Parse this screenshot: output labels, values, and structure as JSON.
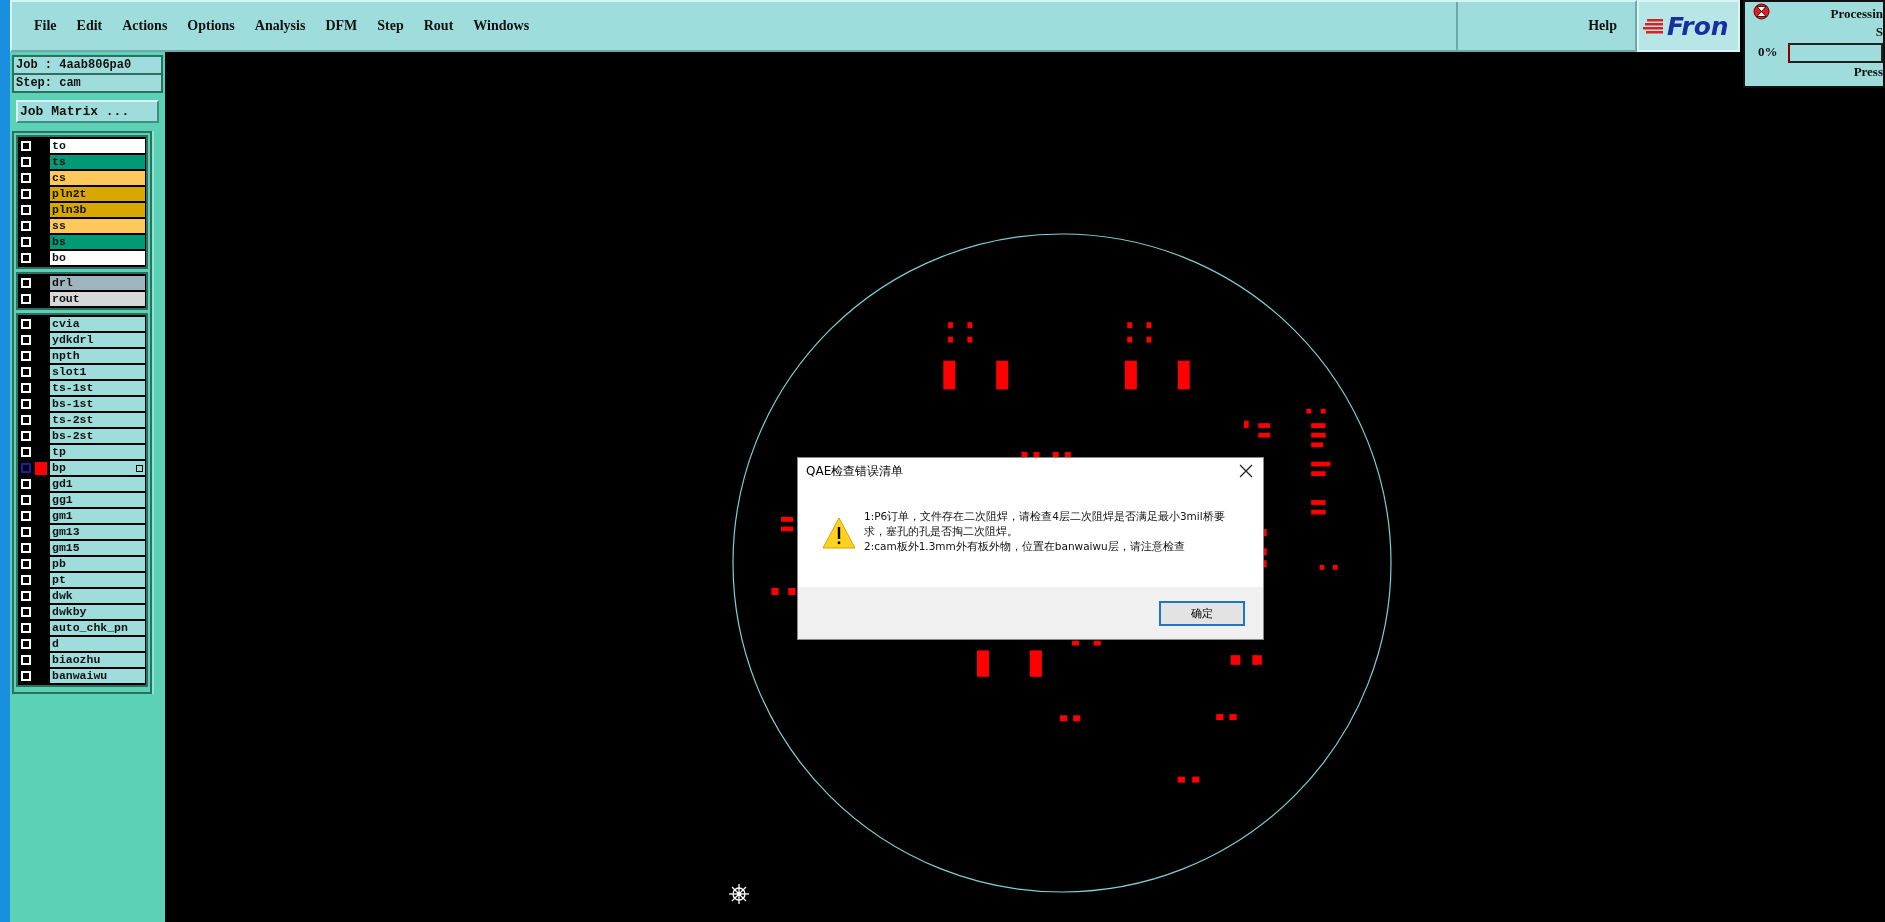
{
  "menu": {
    "items": [
      "File",
      "Edit",
      "Actions",
      "Options",
      "Analysis",
      "DFM",
      "Step",
      "Rout",
      "Windows"
    ],
    "help": "Help"
  },
  "logo": {
    "text": "Fron"
  },
  "processing": {
    "title": "Processin",
    "subtitle": "S",
    "percent": "0%",
    "level": 0,
    "hint": "Press"
  },
  "job": {
    "job": "Job : 4aab806pa0",
    "step": "Step: cam",
    "matrix_button": "Job Matrix ..."
  },
  "layer_groups": [
    {
      "layers": [
        {
          "name": "to",
          "color": "#ffffff",
          "checked": false,
          "active": false
        },
        {
          "name": "ts",
          "color": "#009a76",
          "checked": false,
          "active": false
        },
        {
          "name": "cs",
          "color": "#ffc85a",
          "checked": false,
          "active": false
        },
        {
          "name": "pln2t",
          "color": "#d9a800",
          "checked": false,
          "active": false
        },
        {
          "name": "pln3b",
          "color": "#d9a800",
          "checked": false,
          "active": false
        },
        {
          "name": "ss",
          "color": "#ffc85a",
          "checked": false,
          "active": false
        },
        {
          "name": "bs",
          "color": "#009a76",
          "checked": false,
          "active": false
        },
        {
          "name": "bo",
          "color": "#ffffff",
          "checked": false,
          "active": false
        }
      ]
    },
    {
      "layers": [
        {
          "name": "drl",
          "color": "#9fb5bd",
          "checked": false,
          "active": false
        },
        {
          "name": "rout",
          "color": "#d8d8d8",
          "checked": false,
          "active": false
        }
      ]
    },
    {
      "layers": [
        {
          "name": "cvia",
          "color": "#9fdcdc",
          "checked": false,
          "active": false
        },
        {
          "name": "ydkdrl",
          "color": "#9fdcdc",
          "checked": false,
          "active": false
        },
        {
          "name": "npth",
          "color": "#9fdcdc",
          "checked": false,
          "active": false
        },
        {
          "name": "slot1",
          "color": "#9fdcdc",
          "checked": false,
          "active": false
        },
        {
          "name": "ts-1st",
          "color": "#9fdcdc",
          "checked": false,
          "active": false
        },
        {
          "name": "bs-1st",
          "color": "#9fdcdc",
          "checked": false,
          "active": false
        },
        {
          "name": "ts-2st",
          "color": "#9fdcdc",
          "checked": false,
          "active": false
        },
        {
          "name": "bs-2st",
          "color": "#9fdcdc",
          "checked": false,
          "active": false
        },
        {
          "name": "tp",
          "color": "#9fdcdc",
          "checked": false,
          "active": false
        },
        {
          "name": "bp",
          "color": "#9fdcdc",
          "checked": false,
          "active": true
        },
        {
          "name": "gd1",
          "color": "#9fdcdc",
          "checked": false,
          "active": false
        },
        {
          "name": "gg1",
          "color": "#9fdcdc",
          "checked": false,
          "active": false
        },
        {
          "name": "gm1",
          "color": "#9fdcdc",
          "checked": false,
          "active": false
        },
        {
          "name": "gm13",
          "color": "#9fdcdc",
          "checked": false,
          "active": false
        },
        {
          "name": "gm15",
          "color": "#9fdcdc",
          "checked": false,
          "active": false
        },
        {
          "name": "pb",
          "color": "#9fdcdc",
          "checked": false,
          "active": false
        },
        {
          "name": "pt",
          "color": "#9fdcdc",
          "checked": false,
          "active": false
        },
        {
          "name": "dwk",
          "color": "#9fdcdc",
          "checked": false,
          "active": false
        },
        {
          "name": "dwkby",
          "color": "#9fdcdc",
          "checked": false,
          "active": false
        },
        {
          "name": "auto_chk_pn",
          "color": "#9fdcdc",
          "checked": false,
          "active": false
        },
        {
          "name": "d",
          "color": "#9fdcdc",
          "checked": false,
          "active": false
        },
        {
          "name": "biaozhu",
          "color": "#9fdcdc",
          "checked": false,
          "active": false
        },
        {
          "name": "banwaiwu",
          "color": "#9fdcdc",
          "checked": false,
          "active": false
        }
      ]
    }
  ],
  "dialog": {
    "title": "QAE检查错误清单",
    "messages": [
      " 1:P6订单，文件存在二次阻焊，请检查4层二次阻焊是否满足最小3mil桥要求，塞孔的孔是否掏二次阻焊。",
      " 2:cam板外1.3mm外有板外物，位置在banwaiwu层，请注意检查"
    ],
    "ok_button": "确定"
  }
}
